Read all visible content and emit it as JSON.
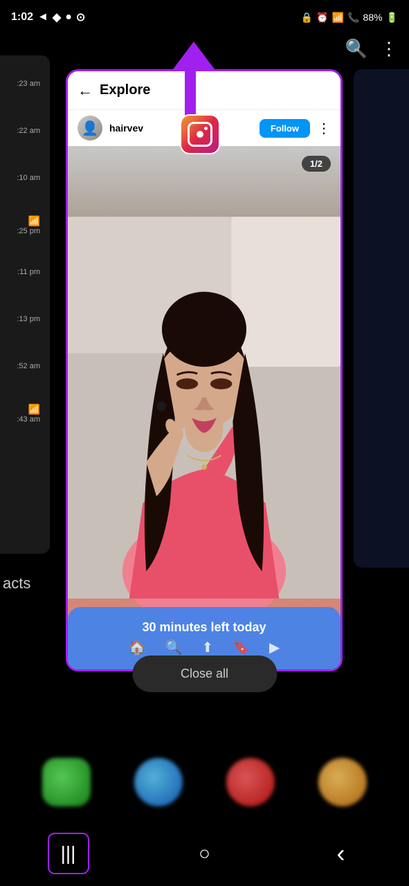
{
  "statusBar": {
    "time": "1:02",
    "battery": "88%",
    "signal": "4G"
  },
  "topIcons": {
    "searchLabel": "🔍",
    "menuLabel": "⋮"
  },
  "instagramApp": {
    "headerTitle": "Explore",
    "backIcon": "←",
    "username": "hairvev",
    "followButton": "Follow",
    "moreIcon": "⋮",
    "counterBadge": "1/2",
    "screenTimeText": "30 minutes left today"
  },
  "closeAllButton": "Close all",
  "leftStripTimes": [
    ":23 am",
    ":22 am",
    ":10 am",
    ":25 pm",
    ":11 pm",
    ":13 pm",
    ":52 am",
    ":43 am"
  ],
  "navBar": {
    "recentsIcon": "|||",
    "homeIcon": "○",
    "backIcon": "‹"
  }
}
